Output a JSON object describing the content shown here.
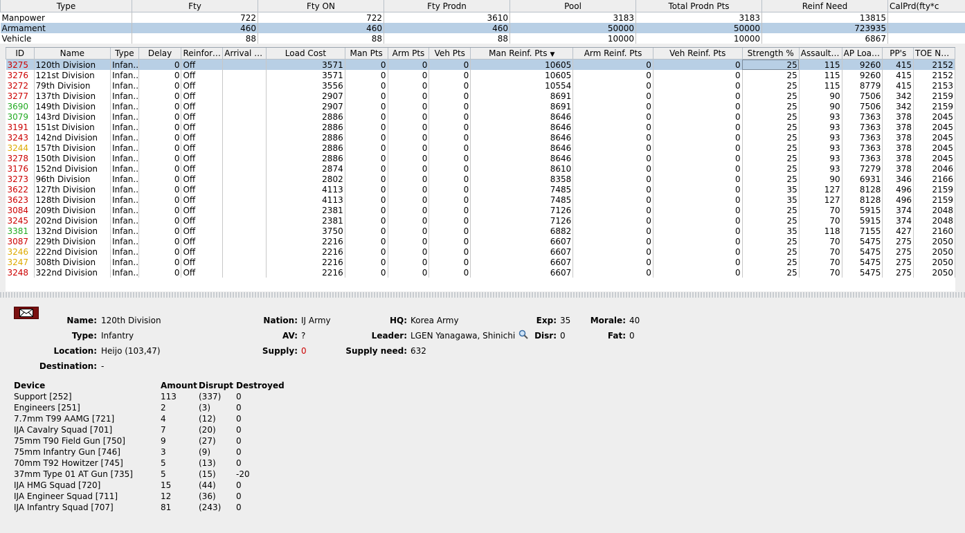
{
  "summary": {
    "columns": [
      "Type",
      "Fty",
      "Fty ON",
      "Fty Prodn",
      "Pool",
      "Total Prodn Pts",
      "Reinf Need",
      "CalPrd(fty*c"
    ],
    "rows": [
      {
        "type": "Manpower",
        "fty": "722",
        "fty_on": "722",
        "fty_prodn": "3610",
        "pool": "3183",
        "total": "3183",
        "reinf": "13815",
        "calprd": ""
      },
      {
        "type": "Armament",
        "fty": "460",
        "fty_on": "460",
        "fty_prodn": "460",
        "pool": "50000",
        "total": "50000",
        "reinf": "723935",
        "calprd": ""
      },
      {
        "type": "Vehicle",
        "fty": "88",
        "fty_on": "88",
        "fty_prodn": "88",
        "pool": "10000",
        "total": "10000",
        "reinf": "6867",
        "calprd": ""
      }
    ]
  },
  "grid": {
    "columns": [
      "ID",
      "Name",
      "Type",
      "Delay",
      "Reinforce",
      "Arrival Port",
      "Load Cost",
      "Man Pts",
      "Arm Pts",
      "Veh Pts",
      "Man Reinf. Pts",
      "Arm Reinf. Pts",
      "Veh Reinf. Pts",
      "Strength %",
      "Assault V...",
      "AP Load ...",
      "PP's",
      "TOE Num"
    ],
    "sort_arrow": "▼",
    "rows": [
      {
        "id": "3275",
        "c": "red",
        "name": "120th Division",
        "type": "Infan...",
        "delay": "0",
        "reinf": "Off",
        "port": "",
        "load": "3571",
        "man": "0",
        "arm": "0",
        "veh": "0",
        "mr": "10605",
        "ar": "0",
        "vr": "0",
        "str": "25",
        "av": "115",
        "ap": "9260",
        "pp": "415",
        "toe": "2152"
      },
      {
        "id": "3276",
        "c": "red",
        "name": "121st Division",
        "type": "Infan...",
        "delay": "0",
        "reinf": "Off",
        "port": "",
        "load": "3571",
        "man": "0",
        "arm": "0",
        "veh": "0",
        "mr": "10605",
        "ar": "0",
        "vr": "0",
        "str": "25",
        "av": "115",
        "ap": "9260",
        "pp": "415",
        "toe": "2152"
      },
      {
        "id": "3272",
        "c": "red",
        "name": "79th Division",
        "type": "Infan...",
        "delay": "0",
        "reinf": "Off",
        "port": "",
        "load": "3556",
        "man": "0",
        "arm": "0",
        "veh": "0",
        "mr": "10554",
        "ar": "0",
        "vr": "0",
        "str": "25",
        "av": "115",
        "ap": "8779",
        "pp": "415",
        "toe": "2153"
      },
      {
        "id": "3277",
        "c": "red",
        "name": "137th Division",
        "type": "Infan...",
        "delay": "0",
        "reinf": "Off",
        "port": "",
        "load": "2907",
        "man": "0",
        "arm": "0",
        "veh": "0",
        "mr": "8691",
        "ar": "0",
        "vr": "0",
        "str": "25",
        "av": "90",
        "ap": "7506",
        "pp": "342",
        "toe": "2159"
      },
      {
        "id": "3690",
        "c": "green",
        "name": "149th Division",
        "type": "Infan...",
        "delay": "0",
        "reinf": "Off",
        "port": "",
        "load": "2907",
        "man": "0",
        "arm": "0",
        "veh": "0",
        "mr": "8691",
        "ar": "0",
        "vr": "0",
        "str": "25",
        "av": "90",
        "ap": "7506",
        "pp": "342",
        "toe": "2159"
      },
      {
        "id": "3079",
        "c": "green",
        "name": "143rd Division",
        "type": "Infan...",
        "delay": "0",
        "reinf": "Off",
        "port": "",
        "load": "2886",
        "man": "0",
        "arm": "0",
        "veh": "0",
        "mr": "8646",
        "ar": "0",
        "vr": "0",
        "str": "25",
        "av": "93",
        "ap": "7363",
        "pp": "378",
        "toe": "2045"
      },
      {
        "id": "3191",
        "c": "red",
        "name": "151st Division",
        "type": "Infan...",
        "delay": "0",
        "reinf": "Off",
        "port": "",
        "load": "2886",
        "man": "0",
        "arm": "0",
        "veh": "0",
        "mr": "8646",
        "ar": "0",
        "vr": "0",
        "str": "25",
        "av": "93",
        "ap": "7363",
        "pp": "378",
        "toe": "2045"
      },
      {
        "id": "3243",
        "c": "red",
        "name": "142nd Division",
        "type": "Infan...",
        "delay": "0",
        "reinf": "Off",
        "port": "",
        "load": "2886",
        "man": "0",
        "arm": "0",
        "veh": "0",
        "mr": "8646",
        "ar": "0",
        "vr": "0",
        "str": "25",
        "av": "93",
        "ap": "7363",
        "pp": "378",
        "toe": "2045"
      },
      {
        "id": "3244",
        "c": "yellow",
        "name": "157th Division",
        "type": "Infan...",
        "delay": "0",
        "reinf": "Off",
        "port": "",
        "load": "2886",
        "man": "0",
        "arm": "0",
        "veh": "0",
        "mr": "8646",
        "ar": "0",
        "vr": "0",
        "str": "25",
        "av": "93",
        "ap": "7363",
        "pp": "378",
        "toe": "2045"
      },
      {
        "id": "3278",
        "c": "red",
        "name": "150th Division",
        "type": "Infan...",
        "delay": "0",
        "reinf": "Off",
        "port": "",
        "load": "2886",
        "man": "0",
        "arm": "0",
        "veh": "0",
        "mr": "8646",
        "ar": "0",
        "vr": "0",
        "str": "25",
        "av": "93",
        "ap": "7363",
        "pp": "378",
        "toe": "2045"
      },
      {
        "id": "3176",
        "c": "red",
        "name": "152nd Division",
        "type": "Infan...",
        "delay": "0",
        "reinf": "Off",
        "port": "",
        "load": "2874",
        "man": "0",
        "arm": "0",
        "veh": "0",
        "mr": "8610",
        "ar": "0",
        "vr": "0",
        "str": "25",
        "av": "93",
        "ap": "7279",
        "pp": "378",
        "toe": "2046"
      },
      {
        "id": "3273",
        "c": "red",
        "name": "96th Division",
        "type": "Infan...",
        "delay": "0",
        "reinf": "Off",
        "port": "",
        "load": "2802",
        "man": "0",
        "arm": "0",
        "veh": "0",
        "mr": "8358",
        "ar": "0",
        "vr": "0",
        "str": "25",
        "av": "90",
        "ap": "6931",
        "pp": "346",
        "toe": "2166"
      },
      {
        "id": "3622",
        "c": "red",
        "name": "127th Division",
        "type": "Infan...",
        "delay": "0",
        "reinf": "Off",
        "port": "",
        "load": "4113",
        "man": "0",
        "arm": "0",
        "veh": "0",
        "mr": "7485",
        "ar": "0",
        "vr": "0",
        "str": "35",
        "av": "127",
        "ap": "8128",
        "pp": "496",
        "toe": "2159"
      },
      {
        "id": "3623",
        "c": "red",
        "name": "128th Division",
        "type": "Infan...",
        "delay": "0",
        "reinf": "Off",
        "port": "",
        "load": "4113",
        "man": "0",
        "arm": "0",
        "veh": "0",
        "mr": "7485",
        "ar": "0",
        "vr": "0",
        "str": "35",
        "av": "127",
        "ap": "8128",
        "pp": "496",
        "toe": "2159"
      },
      {
        "id": "3084",
        "c": "red",
        "name": "209th Division",
        "type": "Infan...",
        "delay": "0",
        "reinf": "Off",
        "port": "",
        "load": "2381",
        "man": "0",
        "arm": "0",
        "veh": "0",
        "mr": "7126",
        "ar": "0",
        "vr": "0",
        "str": "25",
        "av": "70",
        "ap": "5915",
        "pp": "374",
        "toe": "2048"
      },
      {
        "id": "3245",
        "c": "red",
        "name": "202nd Division",
        "type": "Infan...",
        "delay": "0",
        "reinf": "Off",
        "port": "",
        "load": "2381",
        "man": "0",
        "arm": "0",
        "veh": "0",
        "mr": "7126",
        "ar": "0",
        "vr": "0",
        "str": "25",
        "av": "70",
        "ap": "5915",
        "pp": "374",
        "toe": "2048"
      },
      {
        "id": "3381",
        "c": "green",
        "name": "132nd Division",
        "type": "Infan...",
        "delay": "0",
        "reinf": "Off",
        "port": "",
        "load": "3750",
        "man": "0",
        "arm": "0",
        "veh": "0",
        "mr": "6882",
        "ar": "0",
        "vr": "0",
        "str": "35",
        "av": "118",
        "ap": "7155",
        "pp": "427",
        "toe": "2160"
      },
      {
        "id": "3087",
        "c": "red",
        "name": "229th Division",
        "type": "Infan...",
        "delay": "0",
        "reinf": "Off",
        "port": "",
        "load": "2216",
        "man": "0",
        "arm": "0",
        "veh": "0",
        "mr": "6607",
        "ar": "0",
        "vr": "0",
        "str": "25",
        "av": "70",
        "ap": "5475",
        "pp": "275",
        "toe": "2050"
      },
      {
        "id": "3246",
        "c": "yellow",
        "name": "222nd Division",
        "type": "Infan...",
        "delay": "0",
        "reinf": "Off",
        "port": "",
        "load": "2216",
        "man": "0",
        "arm": "0",
        "veh": "0",
        "mr": "6607",
        "ar": "0",
        "vr": "0",
        "str": "25",
        "av": "70",
        "ap": "5475",
        "pp": "275",
        "toe": "2050"
      },
      {
        "id": "3247",
        "c": "yellow",
        "name": "308th Division",
        "type": "Infan...",
        "delay": "0",
        "reinf": "Off",
        "port": "",
        "load": "2216",
        "man": "0",
        "arm": "0",
        "veh": "0",
        "mr": "6607",
        "ar": "0",
        "vr": "0",
        "str": "25",
        "av": "70",
        "ap": "5475",
        "pp": "275",
        "toe": "2050"
      },
      {
        "id": "3248",
        "c": "red",
        "name": "322nd Division",
        "type": "Infan...",
        "delay": "0",
        "reinf": "Off",
        "port": "",
        "load": "2216",
        "man": "0",
        "arm": "0",
        "veh": "0",
        "mr": "6607",
        "ar": "0",
        "vr": "0",
        "str": "25",
        "av": "70",
        "ap": "5475",
        "pp": "275",
        "toe": "2050"
      }
    ]
  },
  "detail": {
    "labels": {
      "name": "Name:",
      "type": "Type:",
      "location": "Location:",
      "destination": "Destination:",
      "nation": "Nation:",
      "av": "AV:",
      "supply": "Supply:",
      "hq": "HQ:",
      "leader": "Leader:",
      "supply_need": "Supply need:",
      "exp": "Exp:",
      "disr": "Disr:",
      "morale": "Morale:",
      "fat": "Fat:"
    },
    "name": "120th Division",
    "type": "Infantry",
    "location": "Heijo (103,47)",
    "destination": "-",
    "nation": "IJ Army",
    "av": "?",
    "supply": "0",
    "hq": "Korea Army",
    "leader": "LGEN Yanagawa, Shinichi",
    "supply_need": "632",
    "exp": "35",
    "disr": "0",
    "morale": "40",
    "fat": "0",
    "device_headers": [
      "Device",
      "Amount",
      "Disrupt",
      "Destroyed"
    ],
    "devices": [
      [
        "Support [252]",
        "113",
        "(337)",
        "0"
      ],
      [
        "Engineers [251]",
        "2",
        "(3)",
        "0"
      ],
      [
        "7.7mm T99 AAMG [721]",
        "4",
        "(12)",
        "0"
      ],
      [
        "IJA Cavalry Squad [701]",
        "7",
        "(20)",
        "0"
      ],
      [
        "75mm T90 Field Gun [750]",
        "9",
        "(27)",
        "0"
      ],
      [
        "75mm Infantry Gun [746]",
        "3",
        "(9)",
        "0"
      ],
      [
        "70mm T92 Howitzer [745]",
        "5",
        "(13)",
        "0"
      ],
      [
        "37mm Type 01 AT Gun [735]",
        "5",
        "(15)",
        "-20"
      ],
      [
        "IJA HMG Squad [720]",
        "15",
        "(44)",
        "0"
      ],
      [
        "IJA Engineer Squad [711]",
        "12",
        "(36)",
        "0"
      ],
      [
        "IJA Infantry Squad [707]",
        "81",
        "(243)",
        "0"
      ]
    ]
  },
  "colors": {
    "selected_row": "#b8cfe5",
    "id_red": "#cc0000",
    "id_green": "#22aa22",
    "id_yellow": "#ddaa00"
  }
}
